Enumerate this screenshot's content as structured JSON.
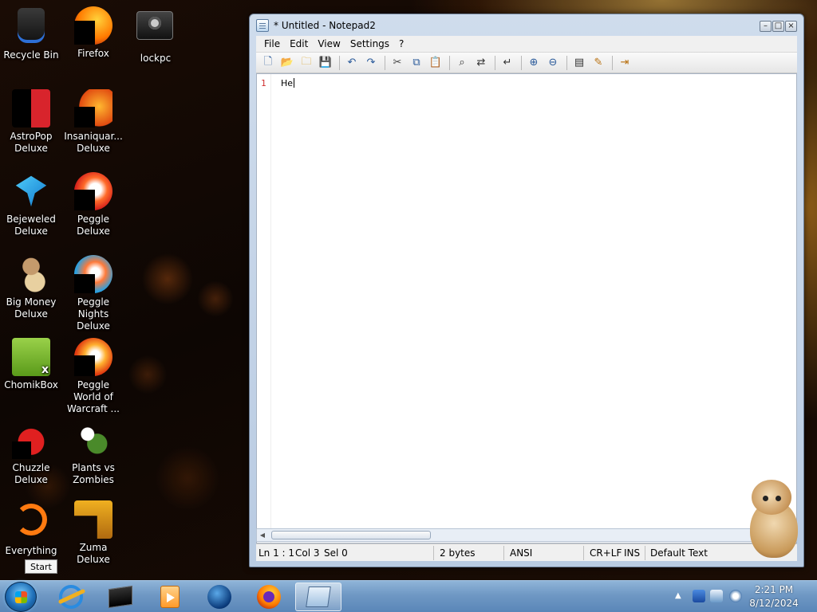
{
  "desktop": {
    "icons": [
      {
        "label": "Recycle Bin",
        "icon": "recycle-bin-icon"
      },
      {
        "label": "Firefox",
        "icon": "firefox-icon"
      },
      {
        "label": "lockpc",
        "icon": "lockpc-icon"
      },
      {
        "label": "AstroPop Deluxe",
        "icon": "astropop-icon"
      },
      {
        "label": "Insaniquar... Deluxe",
        "icon": "insaniquarium-icon"
      },
      {
        "label": "Bejeweled Deluxe",
        "icon": "bejeweled-icon"
      },
      {
        "label": "Peggle Deluxe",
        "icon": "peggle-icon"
      },
      {
        "label": "Big Money Deluxe",
        "icon": "big-money-icon"
      },
      {
        "label": "Peggle Nights Deluxe",
        "icon": "peggle-nights-icon"
      },
      {
        "label": "ChomikBox",
        "icon": "chomikbox-icon"
      },
      {
        "label": "Peggle World of Warcraft ...",
        "icon": "peggle-wow-icon"
      },
      {
        "label": "Chuzzle Deluxe",
        "icon": "chuzzle-icon"
      },
      {
        "label": "Plants vs Zombies",
        "icon": "plants-vs-zombies-icon"
      },
      {
        "label": "Everything",
        "icon": "everything-icon"
      },
      {
        "label": "Zuma Deluxe",
        "icon": "zuma-icon"
      }
    ],
    "tooltip": "Start"
  },
  "window": {
    "title": "* Untitled - Notepad2",
    "controls": {
      "minimize": "–",
      "maximize": "□",
      "close": "×"
    },
    "menu": [
      "File",
      "Edit",
      "View",
      "Settings",
      "?"
    ],
    "toolbar_icons": [
      "new-icon",
      "open-icon",
      "browse-icon",
      "save-icon",
      "|",
      "undo-icon",
      "redo-icon",
      "|",
      "cut-icon",
      "copy-icon",
      "paste-icon",
      "|",
      "find-icon",
      "replace-icon",
      "|",
      "word-wrap-icon",
      "|",
      "zoom-in-icon",
      "zoom-out-icon",
      "|",
      "scheme-icon",
      "customize-scheme-icon",
      "|",
      "exit-icon"
    ],
    "editor": {
      "line_number": "1",
      "text": "He"
    },
    "status": {
      "position": "Ln 1 : 1",
      "column": "Col 3",
      "selection": "Sel 0",
      "size": "2 bytes",
      "encoding": "ANSI",
      "line_endings": "CR+LF",
      "mode": "INS",
      "scheme": "Default Text"
    }
  },
  "taskbar": {
    "apps": [
      "internet-explorer-icon",
      "command-prompt-icon",
      "media-player-icon",
      "globe-icon",
      "firefox-icon",
      "notepad2-icon"
    ],
    "clock": {
      "time": "2:21 PM",
      "date": "8/12/2024"
    }
  }
}
